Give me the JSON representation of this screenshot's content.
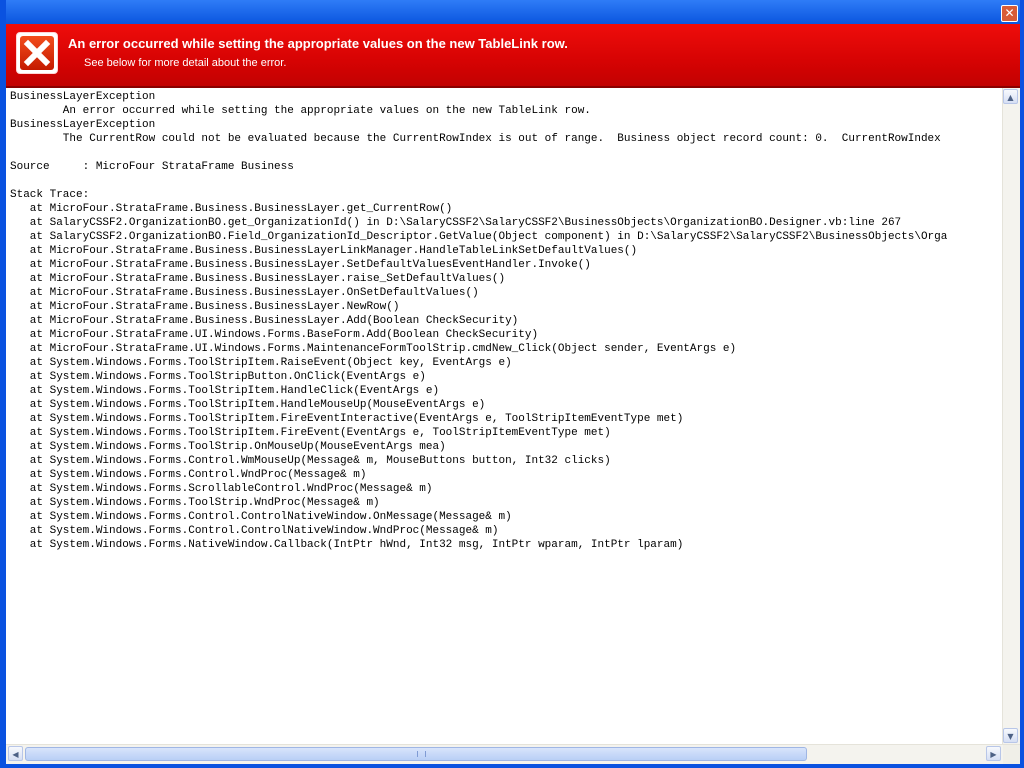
{
  "window": {
    "close_glyph": "✕"
  },
  "banner": {
    "title": "An error occurred while setting the appropriate values on the new TableLink row.",
    "subtitle": "See below for more detail about the error."
  },
  "details": {
    "lines": [
      "BusinessLayerException",
      "        An error occurred while setting the appropriate values on the new TableLink row.",
      "BusinessLayerException",
      "        The CurrentRow could not be evaluated because the CurrentRowIndex is out of range.  Business object record count: 0.  CurrentRowIndex",
      "",
      "Source     : MicroFour StrataFrame Business",
      "",
      "Stack Trace:",
      "   at MicroFour.StrataFrame.Business.BusinessLayer.get_CurrentRow()",
      "   at SalaryCSSF2.OrganizationBO.get_OrganizationId() in D:\\SalaryCSSF2\\SalaryCSSF2\\BusinessObjects\\OrganizationBO.Designer.vb:line 267",
      "   at SalaryCSSF2.OrganizationBO.Field_OrganizationId_Descriptor.GetValue(Object component) in D:\\SalaryCSSF2\\SalaryCSSF2\\BusinessObjects\\Orga",
      "   at MicroFour.StrataFrame.Business.BusinessLayerLinkManager.HandleTableLinkSetDefaultValues()",
      "   at MicroFour.StrataFrame.Business.BusinessLayer.SetDefaultValuesEventHandler.Invoke()",
      "   at MicroFour.StrataFrame.Business.BusinessLayer.raise_SetDefaultValues()",
      "   at MicroFour.StrataFrame.Business.BusinessLayer.OnSetDefaultValues()",
      "   at MicroFour.StrataFrame.Business.BusinessLayer.NewRow()",
      "   at MicroFour.StrataFrame.Business.BusinessLayer.Add(Boolean CheckSecurity)",
      "   at MicroFour.StrataFrame.UI.Windows.Forms.BaseForm.Add(Boolean CheckSecurity)",
      "   at MicroFour.StrataFrame.UI.Windows.Forms.MaintenanceFormToolStrip.cmdNew_Click(Object sender, EventArgs e)",
      "   at System.Windows.Forms.ToolStripItem.RaiseEvent(Object key, EventArgs e)",
      "   at System.Windows.Forms.ToolStripButton.OnClick(EventArgs e)",
      "   at System.Windows.Forms.ToolStripItem.HandleClick(EventArgs e)",
      "   at System.Windows.Forms.ToolStripItem.HandleMouseUp(MouseEventArgs e)",
      "   at System.Windows.Forms.ToolStripItem.FireEventInteractive(EventArgs e, ToolStripItemEventType met)",
      "   at System.Windows.Forms.ToolStripItem.FireEvent(EventArgs e, ToolStripItemEventType met)",
      "   at System.Windows.Forms.ToolStrip.OnMouseUp(MouseEventArgs mea)",
      "   at System.Windows.Forms.Control.WmMouseUp(Message& m, MouseButtons button, Int32 clicks)",
      "   at System.Windows.Forms.Control.WndProc(Message& m)",
      "   at System.Windows.Forms.ScrollableControl.WndProc(Message& m)",
      "   at System.Windows.Forms.ToolStrip.WndProc(Message& m)",
      "   at System.Windows.Forms.Control.ControlNativeWindow.OnMessage(Message& m)",
      "   at System.Windows.Forms.Control.ControlNativeWindow.WndProc(Message& m)",
      "   at System.Windows.Forms.NativeWindow.Callback(IntPtr hWnd, Int32 msg, IntPtr wparam, IntPtr lparam)"
    ]
  },
  "scrollbars": {
    "up_arrow": "▲",
    "down_arrow": "▼",
    "left_arrow": "◀",
    "right_arrow": "▶"
  },
  "colors": {
    "banner_red": "#d60303",
    "titlebar_blue": "#0a55de"
  }
}
